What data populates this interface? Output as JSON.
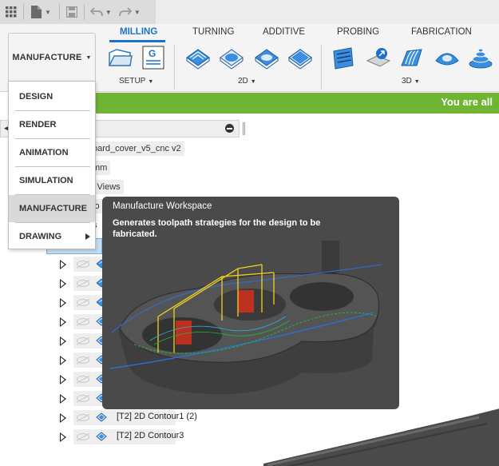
{
  "quick_access": {
    "icons": [
      "grid-icon",
      "file-icon",
      "save-icon",
      "undo-icon",
      "redo-icon"
    ]
  },
  "ribbon": {
    "workspace_button": "MANUFACTURE",
    "tabs": [
      {
        "label": "MILLING",
        "active": true
      },
      {
        "label": "TURNING",
        "active": false
      },
      {
        "label": "ADDITIVE",
        "active": false
      },
      {
        "label": "PROBING",
        "active": false
      },
      {
        "label": "FABRICATION",
        "active": false
      }
    ],
    "groups": [
      {
        "label": "SETUP"
      },
      {
        "label": "2D"
      },
      {
        "label": "3D"
      }
    ]
  },
  "banner": {
    "text": "You are all",
    "color": "#6fb433"
  },
  "workspace_menu": {
    "items": [
      {
        "label": "DESIGN",
        "selected": false
      },
      {
        "label": "RENDER",
        "selected": false
      },
      {
        "label": "ANIMATION",
        "selected": false
      },
      {
        "label": "SIMULATION",
        "selected": false
      },
      {
        "label": "MANUFACTURE",
        "selected": true
      },
      {
        "label": "DRAWING",
        "selected": false,
        "has_submenu": true
      }
    ]
  },
  "browser": {
    "document_name": "oard_cover_v5_cnc v2",
    "units": "mm",
    "named_views": "l Views",
    "partial_1": "lo",
    "partial_2": "s",
    "operations": [
      {
        "label": ""
      },
      {
        "label": ""
      },
      {
        "label": ""
      },
      {
        "label": ""
      },
      {
        "label": ""
      },
      {
        "label": ""
      },
      {
        "label": ""
      },
      {
        "label": ""
      },
      {
        "label": "[T2] 2D Contour1 (2)"
      },
      {
        "label": "[T2] 2D Contour3"
      }
    ]
  },
  "tooltip": {
    "title": "Manufacture Workspace",
    "description": "Generates toolpath strategies for the design to be fabricated."
  },
  "colors": {
    "accent": "#1a73c9",
    "banner": "#6fb433",
    "tooltip_bg": "#4a4a4a"
  }
}
